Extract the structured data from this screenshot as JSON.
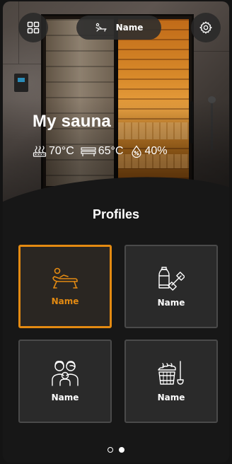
{
  "header": {
    "room_name": "Name",
    "icons": {
      "menu": "grid-icon",
      "room": "lounger-icon",
      "settings": "gear-icon"
    }
  },
  "sauna": {
    "title": "My sauna",
    "stats": [
      {
        "icon": "heater-icon",
        "value": "70°C"
      },
      {
        "icon": "bench-icon",
        "value": "65°C"
      },
      {
        "icon": "humidity-icon",
        "value": "40%"
      }
    ]
  },
  "profiles": {
    "title": "Profiles",
    "items": [
      {
        "label": "Name",
        "icon": "lounger-icon",
        "selected": true
      },
      {
        "label": "Name",
        "icon": "fitness-icon",
        "selected": false
      },
      {
        "label": "Name",
        "icon": "family-icon",
        "selected": false
      },
      {
        "label": "Name",
        "icon": "sauna-bucket-icon",
        "selected": false
      }
    ]
  },
  "pagination": {
    "pages": 2,
    "current": 2
  },
  "colors": {
    "accent": "#e38a12",
    "background": "#171717",
    "card": "#2a2a2a"
  }
}
